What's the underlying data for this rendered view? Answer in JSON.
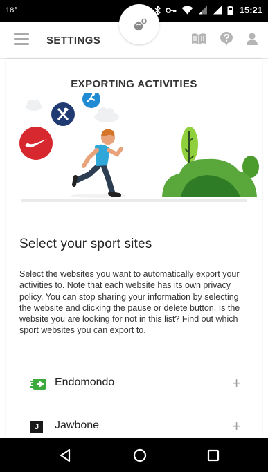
{
  "status_bar": {
    "temperature": "18°",
    "time": "15:21",
    "icons": [
      "bluetooth-icon",
      "key-icon",
      "wifi-icon",
      "signal-icon",
      "signal-icon",
      "battery-icon"
    ]
  },
  "app_bar": {
    "title": "SETTINGS",
    "icons": [
      "menu-icon",
      "sync-icon",
      "book-icon",
      "help-icon",
      "profile-icon"
    ]
  },
  "content": {
    "heading": "EXPORTING ACTIVITIES",
    "subtitle": "Select your sport sites",
    "description": "Select the websites you want to automatically export your activities to. Note that each website has its own privacy policy. You can stop sharing your information by selecting the website and clicking the pause or delete button. Is the website you are looking for not in this list? Find out which sport websites you can export to.",
    "sites": [
      {
        "name": "Endomondo",
        "action": "+",
        "logo_icon": "endomondo-logo-icon"
      },
      {
        "name": "Jawbone",
        "action": "+",
        "logo_icon": "jawbone-logo-icon",
        "logo_letter": "J"
      }
    ]
  },
  "colors": {
    "nike_red": "#d7282f",
    "partner_navy": "#203a72",
    "partner_blue": "#1f8bd3",
    "endomondo_green": "#3caa3c",
    "tree_green": "#5aa83c",
    "runner_shirt": "#2fa7d9"
  },
  "nav_bar": {
    "icons": [
      "back-icon",
      "home-icon",
      "recents-icon"
    ]
  }
}
